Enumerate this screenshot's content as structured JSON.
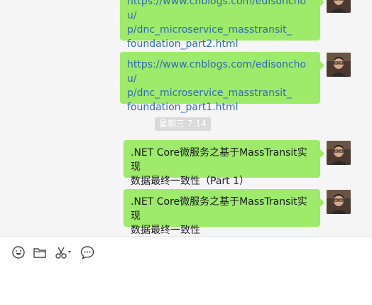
{
  "messages": [
    {
      "type": "link",
      "lines": [
        "https://www.cnblogs.com/edisonchou/",
        "p/dnc_microservice_masstransit_",
        "foundation_part2.html"
      ]
    },
    {
      "type": "link",
      "lines": [
        "https://www.cnblogs.com/edisonchou/",
        "p/dnc_microservice_masstransit_",
        "foundation_part1.html"
      ]
    },
    {
      "type": "text",
      "lines": [
        ".NET Core微服务之基于MassTransit实现",
        "数据最终一致性（Part 1）"
      ]
    },
    {
      "type": "text",
      "lines": [
        ".NET Core微服务之基于MassTransit实现",
        "数据最终一致性"
      ]
    }
  ],
  "timestamp": "星期三 7:14",
  "toolbar": {
    "icons": [
      "emoji-icon",
      "folder-icon",
      "scissors-icon",
      "chat-history-icon"
    ]
  },
  "colors": {
    "bubble": "#9eea6a",
    "link": "#2f6bb5",
    "chat_bg": "#f5f5f5"
  }
}
